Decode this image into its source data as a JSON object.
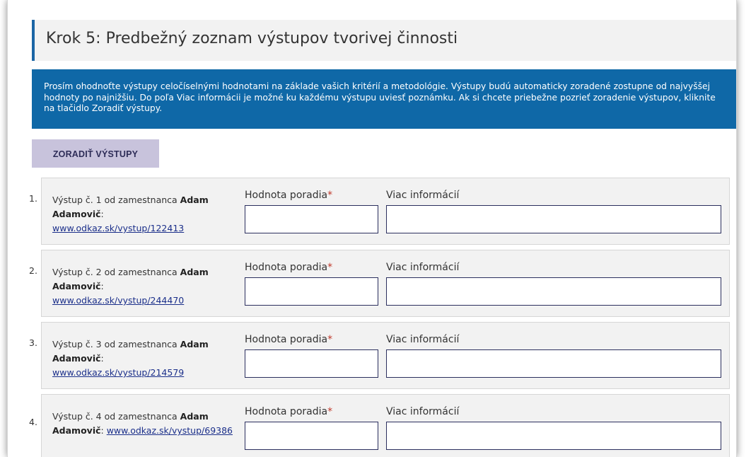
{
  "step": {
    "title": "Krok 5: Predbežný zoznam výstupov tvorivej činnosti"
  },
  "info": {
    "text": "Prosím ohodnoťte výstupy celočíselnými hodnotami na základe vašich kritérií a metodológie. Výstupy budú automaticky zoradené zostupne od najvyššej hodnoty po najnižšiu. Do poľa Viac informácii je možné ku každému výstupu uviesť poznámku. Ak si chcete priebežne pozrieť zoradenie výstupov, kliknite na tlačidlo Zoradiť výstupy."
  },
  "sort_button": {
    "label": "ZORADIŤ VÝSTUPY"
  },
  "fields": {
    "rank_label": "Hodnota poradia",
    "required_mark": "*",
    "info_label": "Viac informácií"
  },
  "items": [
    {
      "number": "1.",
      "prefix": "Výstup č. 1 od zamestnanca ",
      "name": "Adam Adamovič",
      "suffix": ":",
      "link": "www.odkaz.sk/vystup/122413",
      "rank_value": "",
      "info_value": ""
    },
    {
      "number": "2.",
      "prefix": "Výstup č. 2 od zamestnanca ",
      "name": "Adam Adamovič",
      "suffix": ":",
      "link": "www.odkaz.sk/vystup/244470",
      "rank_value": "",
      "info_value": ""
    },
    {
      "number": "3.",
      "prefix": "Výstup č. 3 od zamestnanca ",
      "name": "Adam Adamovič",
      "suffix": ":",
      "link": "www.odkaz.sk/vystup/214579",
      "rank_value": "",
      "info_value": ""
    },
    {
      "number": "4.",
      "prefix": "Výstup č. 4 od zamestnanca ",
      "name": "Adam Adamovič",
      "suffix": ": ",
      "link": "www.odkaz.sk/vystup/69386",
      "rank_value": "",
      "info_value": ""
    }
  ]
}
